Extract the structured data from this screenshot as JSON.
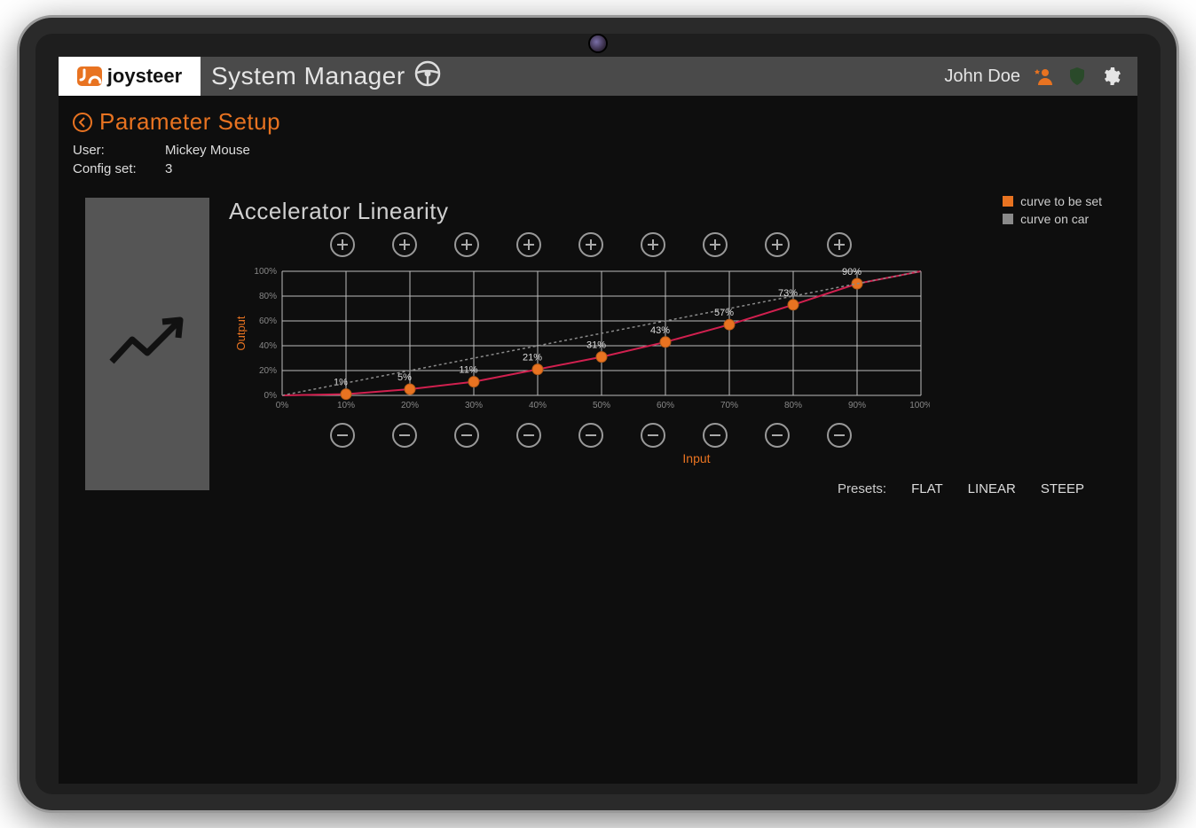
{
  "brand": "joysteer",
  "app_title": "System Manager",
  "header_user": "John Doe",
  "page_title": "Parameter Setup",
  "meta": {
    "user_label": "User:",
    "user_value": "Mickey Mouse",
    "config_label": "Config set:",
    "config_value": "3"
  },
  "chart_title": "Accelerator Linearity",
  "legend": {
    "curve_to_be_set": "curve to be set",
    "curve_on_car": "curve on car"
  },
  "axis": {
    "y_label": "Output",
    "x_label": "Input"
  },
  "presets": {
    "label": "Presets:",
    "flat": "FLAT",
    "linear": "LINEAR",
    "steep": "STEEP"
  },
  "colors": {
    "accent": "#e87321",
    "curve_set": "#e87321",
    "curve_car": "#8a8a8a",
    "grid": "#bfbfbf"
  },
  "chart_data": {
    "type": "line",
    "title": "Accelerator Linearity",
    "xlabel": "Input",
    "ylabel": "Output",
    "xlim": [
      0,
      100
    ],
    "ylim": [
      0,
      100
    ],
    "x_ticks": [
      0,
      10,
      20,
      30,
      40,
      50,
      60,
      70,
      80,
      90,
      100
    ],
    "y_ticks": [
      0,
      20,
      40,
      60,
      80,
      100
    ],
    "series": [
      {
        "name": "curve to be set",
        "color": "#e87321",
        "x": [
          0,
          10,
          20,
          30,
          40,
          50,
          60,
          70,
          80,
          90,
          100
        ],
        "y": [
          0,
          1,
          5,
          11,
          21,
          31,
          43,
          57,
          73,
          90,
          100
        ],
        "point_labels": [
          "",
          "1%",
          "5%",
          "11%",
          "21%",
          "31%",
          "43%",
          "57%",
          "73%",
          "90%",
          ""
        ]
      },
      {
        "name": "curve on car",
        "color": "#8a8a8a",
        "x": [
          0,
          100
        ],
        "y": [
          0,
          100
        ]
      }
    ]
  }
}
